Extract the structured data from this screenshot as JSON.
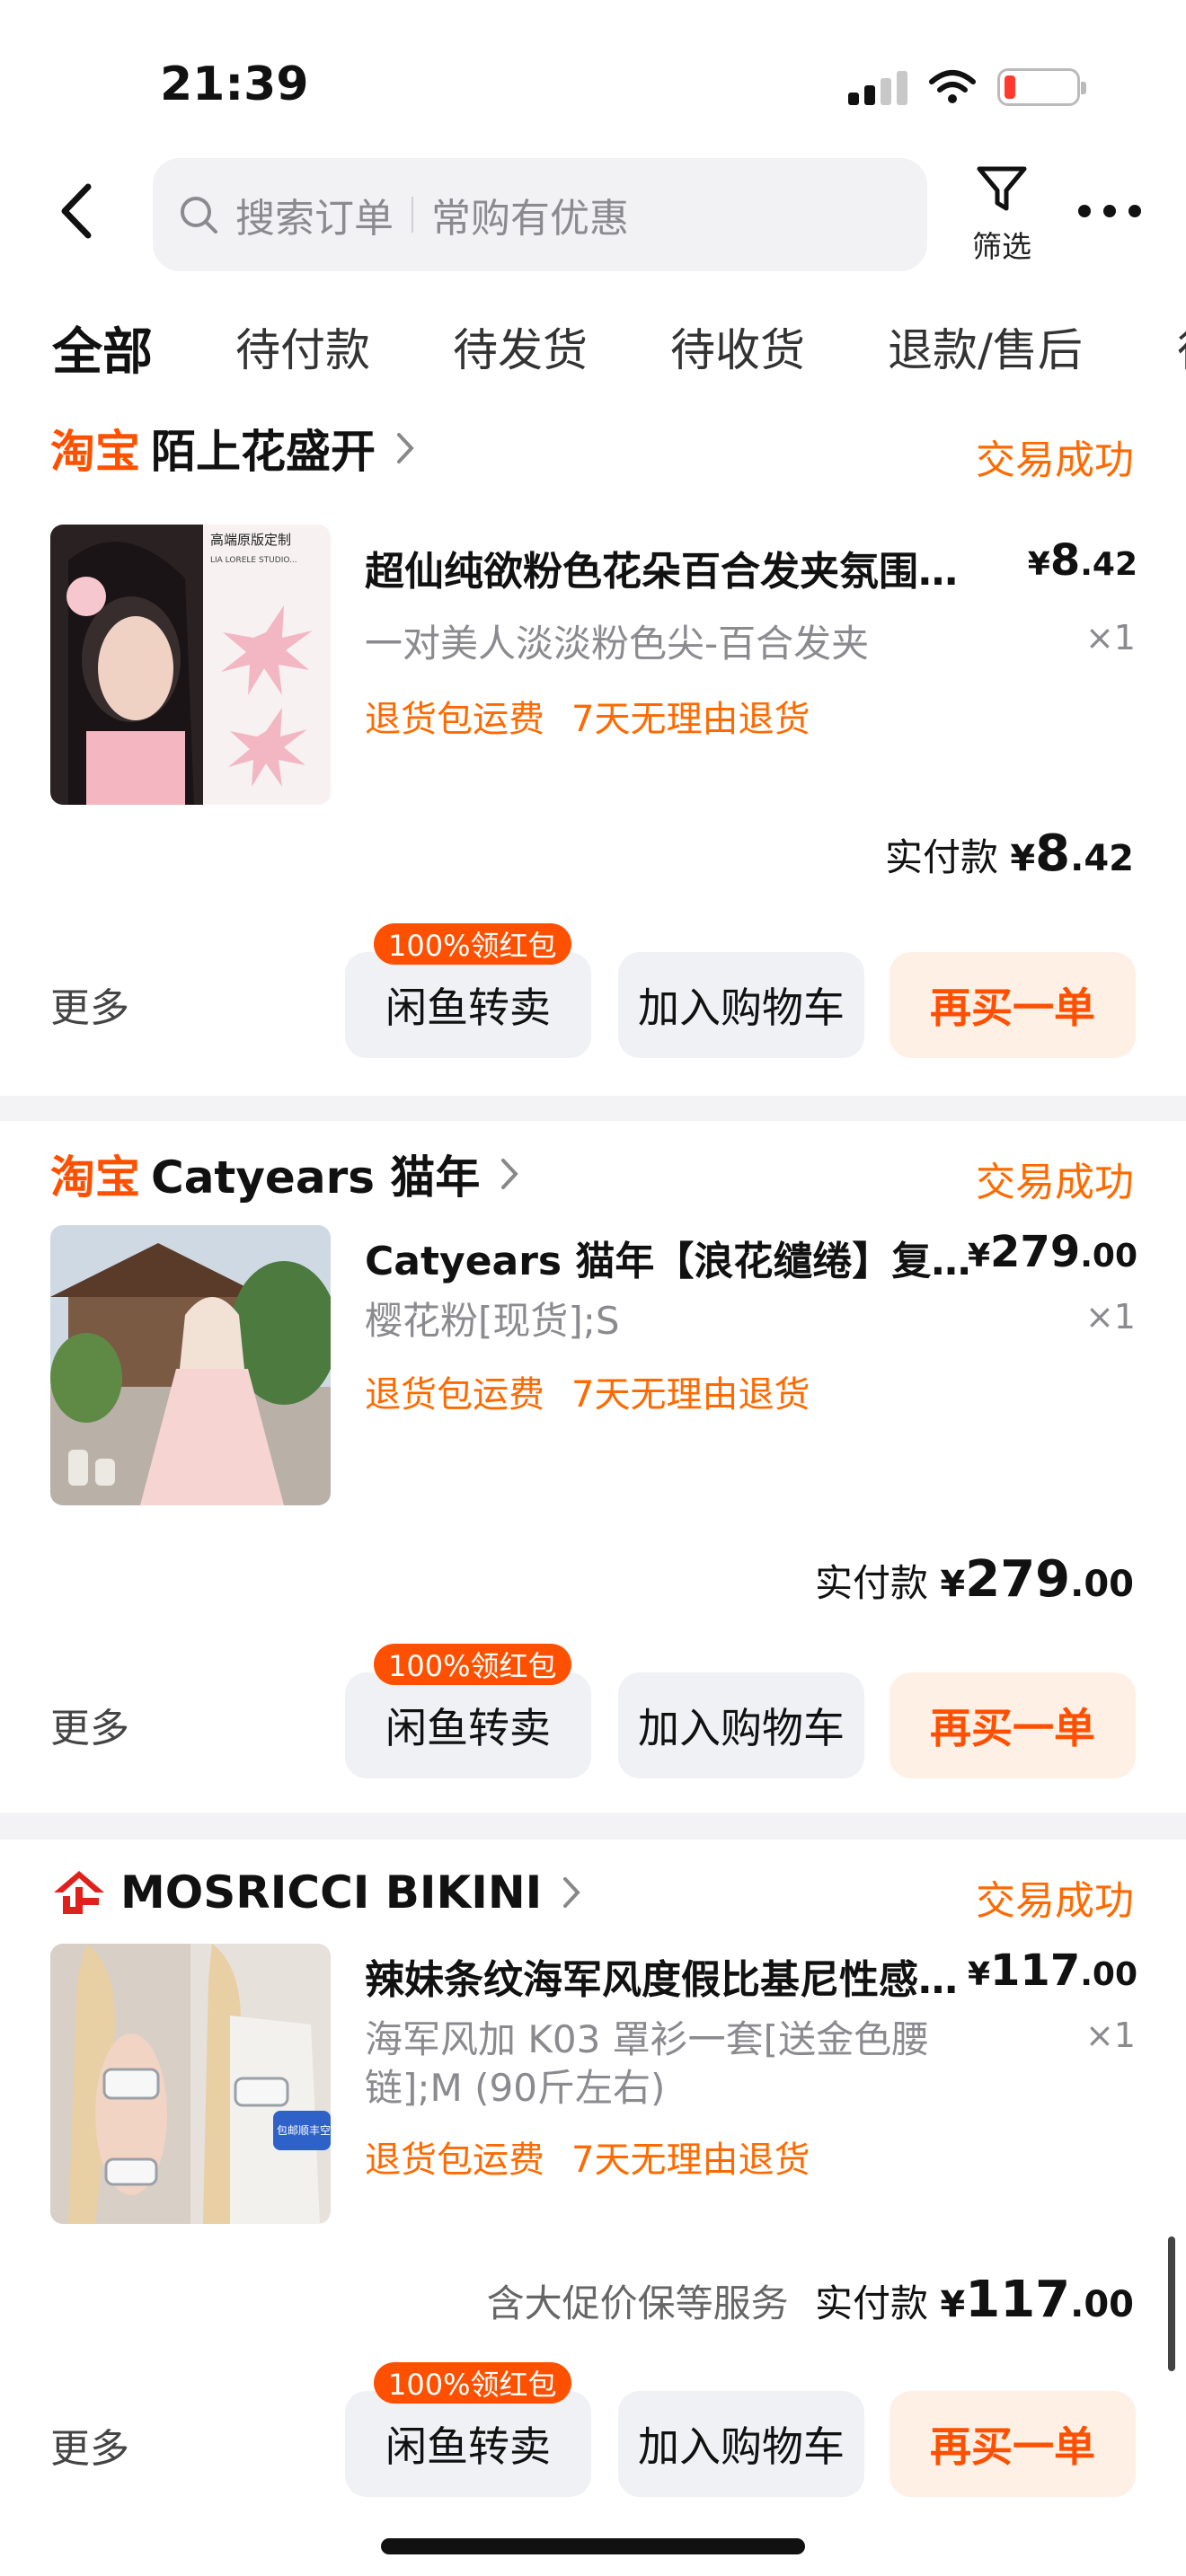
{
  "status_bar": {
    "time": "21:39"
  },
  "header": {
    "search_placeholder": "搜索订单",
    "search_hint": "常购有优惠",
    "filter_label": "筛选"
  },
  "tabs": [
    "全部",
    "待付款",
    "待发货",
    "待收货",
    "退款/售后",
    "待评价"
  ],
  "orders": [
    {
      "shop_badge": "淘宝",
      "shop_name": "陌上花盛开",
      "status": "交易成功",
      "title": "超仙纯欲粉色花朵百合发夹氛围感头饰",
      "price_symbol": "¥",
      "price_int": "8",
      "price_dec": ".42",
      "spec": "一对美人淡淡粉色尖-百合发夹",
      "qty": "×1",
      "tags": [
        "退货包运费",
        "7天无理由退货"
      ],
      "service": "",
      "paid_label": "实付款",
      "paid_symbol": "¥",
      "paid_int": "8",
      "paid_dec": ".42",
      "thumb_text": "高端原版定制",
      "thumb_sub": "LIA LORELE STUDIO...",
      "more_label": "更多",
      "badge": "100%领红包",
      "btn_resell": "闲鱼转卖",
      "btn_cart": "加入购物车",
      "btn_rebuy": "再买一单"
    },
    {
      "shop_badge": "淘宝",
      "shop_name": "Catyears 猫年",
      "status": "交易成功",
      "title": "Catyears 猫年【浪花缱绻】复古连衣裙",
      "price_symbol": "¥",
      "price_int": "279",
      "price_dec": ".00",
      "spec": "樱花粉[现货];S",
      "qty": "×1",
      "tags": [
        "退货包运费",
        "7天无理由退货"
      ],
      "service": "",
      "paid_label": "实付款",
      "paid_symbol": "¥",
      "paid_int": "279",
      "paid_dec": ".00",
      "more_label": "更多",
      "badge": "100%领红包",
      "btn_resell": "闲鱼转卖",
      "btn_cart": "加入购物车",
      "btn_rebuy": "再买一单"
    },
    {
      "shop_badge": "",
      "shop_name": "MOSRICCI BIKINI",
      "status": "交易成功",
      "title": "辣妹条纹海军风度假比基尼性感泳衣",
      "price_symbol": "¥",
      "price_int": "117",
      "price_dec": ".00",
      "spec": "海军风加 K03 罩衫一套[送金色腰链];M (90斤左右)",
      "qty": "×1",
      "tags": [
        "退货包运费",
        "7天无理由退货"
      ],
      "service": "含大促价保等服务",
      "paid_label": "实付款",
      "paid_symbol": "¥",
      "paid_int": "117",
      "paid_dec": ".00",
      "thumb_text": "包邮顺丰空运",
      "more_label": "更多",
      "badge": "100%领红包",
      "btn_resell": "闲鱼转卖",
      "btn_cart": "加入购物车",
      "btn_rebuy": "再买一单"
    }
  ],
  "colors": {
    "accent": "#ff5000",
    "status": "#ff6a00",
    "rebuy_bg": "#fff0e6"
  }
}
